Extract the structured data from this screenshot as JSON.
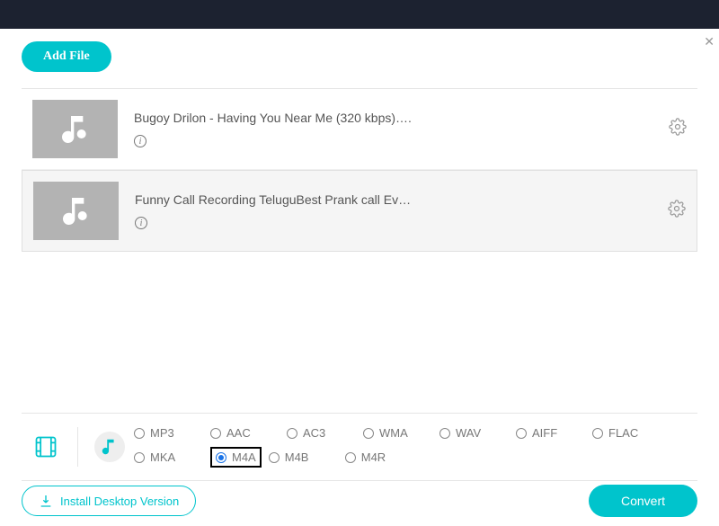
{
  "toolbar": {
    "add_file": "Add File"
  },
  "files": [
    {
      "title": "Bugoy Drilon - Having You Near Me (320 kbps)….",
      "selected": false
    },
    {
      "title": "Funny Call Recording TeluguBest Prank call Ev…",
      "selected": true
    }
  ],
  "categories": {
    "video": "film-icon",
    "audio": "music-icon",
    "active": "audio"
  },
  "formats": {
    "row1": [
      "MP3",
      "AAC",
      "AC3",
      "WMA",
      "WAV",
      "AIFF",
      "FLAC"
    ],
    "row2": [
      "MKA",
      "M4A",
      "M4B",
      "M4R"
    ],
    "selected": "M4A",
    "highlighted": "M4A"
  },
  "footer": {
    "install": "Install Desktop Version",
    "convert": "Convert"
  }
}
